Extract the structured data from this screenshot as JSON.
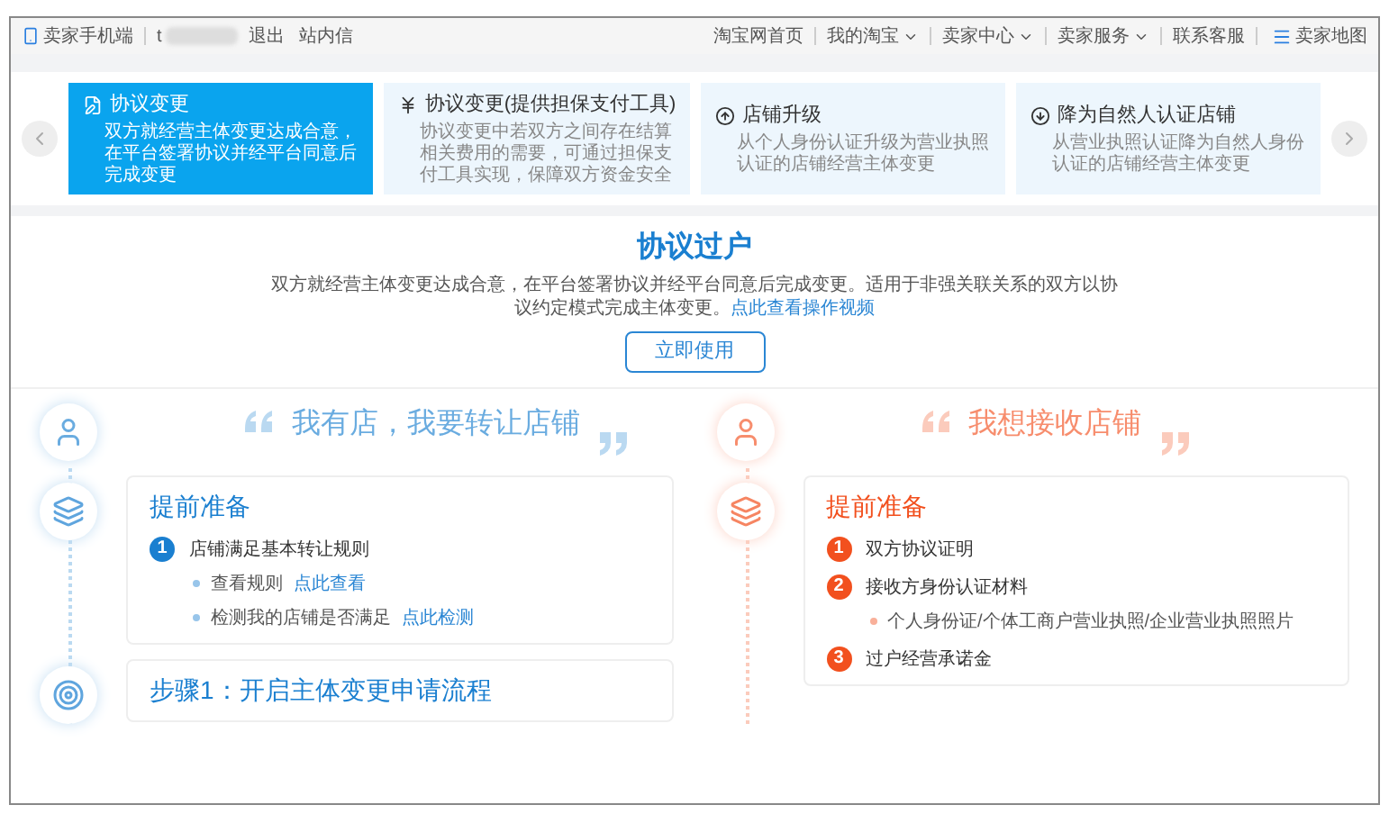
{
  "top_bar": {
    "mobile_link": "卖家手机端",
    "username": "t",
    "logout": "退出",
    "messages": "站内信",
    "nav": [
      {
        "label": "淘宝网首页",
        "dropdown": false
      },
      {
        "label": "我的淘宝",
        "dropdown": true
      },
      {
        "label": "卖家中心",
        "dropdown": true
      },
      {
        "label": "卖家服务",
        "dropdown": true
      },
      {
        "label": "联系客服",
        "dropdown": false
      }
    ],
    "site_map": "卖家地图"
  },
  "options": [
    {
      "kind": "agreement",
      "title": "协议变更",
      "description": "双方就经营主体变更达成合意，在平台签署协议并经平台同意后完成变更",
      "selected": true
    },
    {
      "kind": "guarantee",
      "title": "协议变更(提供担保支付工具)",
      "description": "协议变更中若双方之间存在结算相关费用的需要，可通过担保支付工具实现，保障双方资金安全",
      "selected": false
    },
    {
      "kind": "upgrade",
      "title": "店铺升级",
      "description": "从个人身份认证升级为营业执照认证的店铺经营主体变更",
      "selected": false
    },
    {
      "kind": "downgrade",
      "title": "降为自然人认证店铺",
      "description": "从营业执照认证降为自然人身份认证的店铺经营主体变更",
      "selected": false
    }
  ],
  "hero": {
    "title": "协议过户",
    "description": "双方就经营主体变更达成合意，在平台签署协议并经平台同意后完成变更。适用于非强关联关系的双方以协议约定模式完成主体变更。",
    "link": "点此查看操作视频",
    "button": "立即使用"
  },
  "columns": [
    {
      "color": "#1a7fd0",
      "quote": "我有店，我要转让店铺",
      "sections": [
        {
          "kind": "prepare",
          "title": "提前准备",
          "items": [
            {
              "number": "1",
              "text": "店铺满足基本转让规则",
              "subitems": [
                {
                  "text": "查看规则",
                  "link": "点此查看"
                },
                {
                  "text": "检测我的店铺是否满足",
                  "link": "点此检测"
                }
              ]
            }
          ]
        },
        {
          "kind": "step",
          "title": "步骤1：开启主体变更申请流程"
        }
      ]
    },
    {
      "color": "#f2501e",
      "quote": "我想接收店铺",
      "sections": [
        {
          "kind": "prepare",
          "title": "提前准备",
          "items": [
            {
              "number": "1",
              "text": "双方协议证明"
            },
            {
              "number": "2",
              "text": "接收方身份认证材料",
              "subitems": [
                {
                  "text": "个人身份证/个体工商户营业执照/企业营业执照照片"
                }
              ]
            },
            {
              "number": "3",
              "text": "过户经营承诺金"
            }
          ]
        }
      ]
    }
  ]
}
